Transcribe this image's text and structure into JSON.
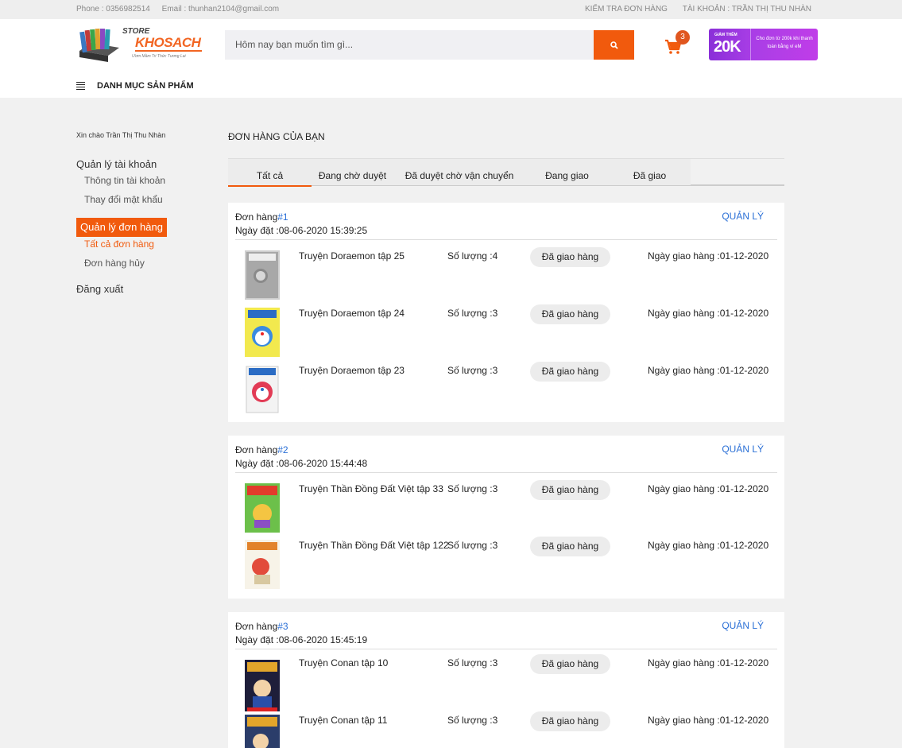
{
  "topbar": {
    "phone": "Phone : 0356982514",
    "email": "Email : thunhan2104@gmail.com",
    "check_order": "Kiểm tra đơn hàng",
    "account": "Tài khoản : Trần Thị Thu Nhàn"
  },
  "header": {
    "logo_store": "STORE",
    "logo_name": "KHOSACH",
    "logo_slogan": "Ươm Mầm Tri Thức Tương Lai",
    "search_placeholder": "Hôm nay bạn muốn tìm gì...",
    "cart_count": "3",
    "promo_small": "GIẢM THÊM",
    "promo_big": "20K",
    "promo_note": "Cho đơn từ 200k khi thanh toán bằng ví eM",
    "category_nav": "DANH MỤC SẢN PHẨM"
  },
  "sidebar": {
    "greeting": "Xin chào Trần Thị Thu Nhàn",
    "account_mgmt": "Quản lý tài khoản",
    "account_info": "Thông tin tài khoản",
    "change_password": "Thay đổi mật khẩu",
    "order_mgmt": "Quản lý đơn hàng",
    "all_orders": "Tất cả đơn hàng",
    "cancelled_orders": "Đơn hàng hủy",
    "logout": "Đăng xuất"
  },
  "main": {
    "title": "Đơn hàng của bạn",
    "tabs": [
      {
        "label": "Tất cả"
      },
      {
        "label": "Đang chờ duyệt"
      },
      {
        "label": "Đã duyệt chờ vận chuyển"
      },
      {
        "label": "Đang giao"
      },
      {
        "label": "Đã giao"
      }
    ]
  },
  "orders": [
    {
      "label": "Đơn hàng",
      "number": "#1",
      "date": "Ngày đặt :08-06-2020 15:39:25",
      "manage": "QUẢN LÝ",
      "items": [
        {
          "title": "Truyện Doraemon tập 25",
          "qty": "Số lượng :4",
          "status": "Đã giao hàng",
          "delivery": "Ngày giao hàng :01-12-2020"
        },
        {
          "title": "Truyện Doraemon tập 24",
          "qty": "Số lượng :3",
          "status": "Đã giao hàng",
          "delivery": "Ngày giao hàng :01-12-2020"
        },
        {
          "title": "Truyện Doraemon tập 23",
          "qty": "Số lượng :3",
          "status": "Đã giao hàng",
          "delivery": "Ngày giao hàng :01-12-2020"
        }
      ]
    },
    {
      "label": "Đơn hàng",
      "number": "#2",
      "date": "Ngày đặt :08-06-2020 15:44:48",
      "manage": "QUẢN LÝ",
      "items": [
        {
          "title": "Truyện Thần Đồng Đất Việt tập 33",
          "qty": "Số lượng :3",
          "status": "Đã giao hàng",
          "delivery": "Ngày giao hàng :01-12-2020"
        },
        {
          "title": "Truyện Thần Đồng Đất Việt tập 122",
          "qty": "Số lượng :3",
          "status": "Đã giao hàng",
          "delivery": "Ngày giao hàng :01-12-2020"
        }
      ]
    },
    {
      "label": "Đơn hàng",
      "number": "#3",
      "date": "Ngày đặt :08-06-2020 15:45:19",
      "manage": "QUẢN LÝ",
      "items": [
        {
          "title": "Truyện Conan tập 10",
          "qty": "Số lượng :3",
          "status": "Đã giao hàng",
          "delivery": "Ngày giao hàng :01-12-2020"
        },
        {
          "title": "Truyện Conan tập 11",
          "qty": "Số lượng :3",
          "status": "Đã giao hàng",
          "delivery": "Ngày giao hàng :01-12-2020"
        }
      ]
    }
  ],
  "colors": {
    "accent": "#f15a0d",
    "link": "#2a6fd6"
  }
}
